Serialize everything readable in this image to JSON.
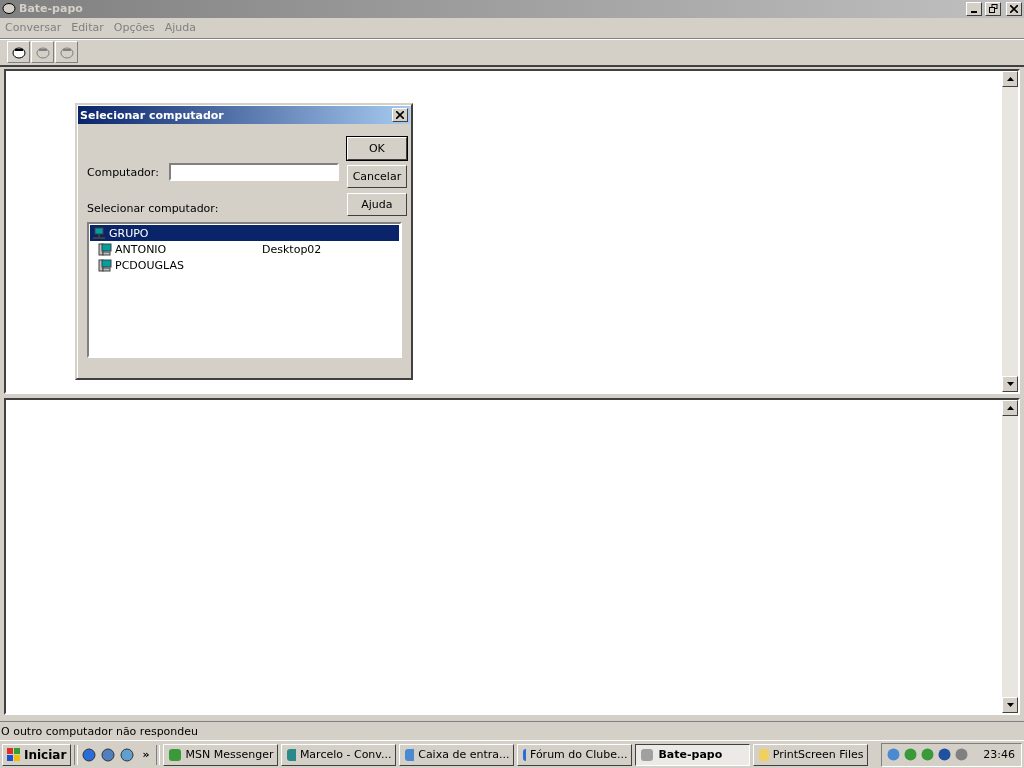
{
  "window": {
    "title": "Bate-papo",
    "active": false
  },
  "menu": [
    "Conversar",
    "Editar",
    "Opções",
    "Ajuda"
  ],
  "dialog": {
    "title": "Selecionar computador",
    "computer_label": "Computador:",
    "list_label": "Selecionar computador:",
    "buttons": [
      "OK",
      "Cancelar",
      "Ajuda"
    ],
    "tree": [
      {
        "name": "GRUPO",
        "selected": true,
        "children": [
          {
            "name": "ANTONIO",
            "comment": "Desktop02",
            "selected": false
          },
          {
            "name": "PCDOUGLAS",
            "selected": false
          }
        ]
      }
    ]
  },
  "status_bar": "O outro computador não respondeu",
  "taskbar": {
    "start": "Iniciar",
    "overflow": "»",
    "tasks": [
      {
        "label": "MSN Messenger",
        "selected": false
      },
      {
        "label": "Marcelo - Conv...",
        "selected": false
      },
      {
        "label": "Caixa de entra...",
        "selected": false
      },
      {
        "label": "Fórum do Clube...",
        "selected": false
      },
      {
        "label": "Bate-papo",
        "selected": true
      },
      {
        "label": "PrintScreen Files",
        "selected": false
      }
    ],
    "clock": "23:46"
  }
}
